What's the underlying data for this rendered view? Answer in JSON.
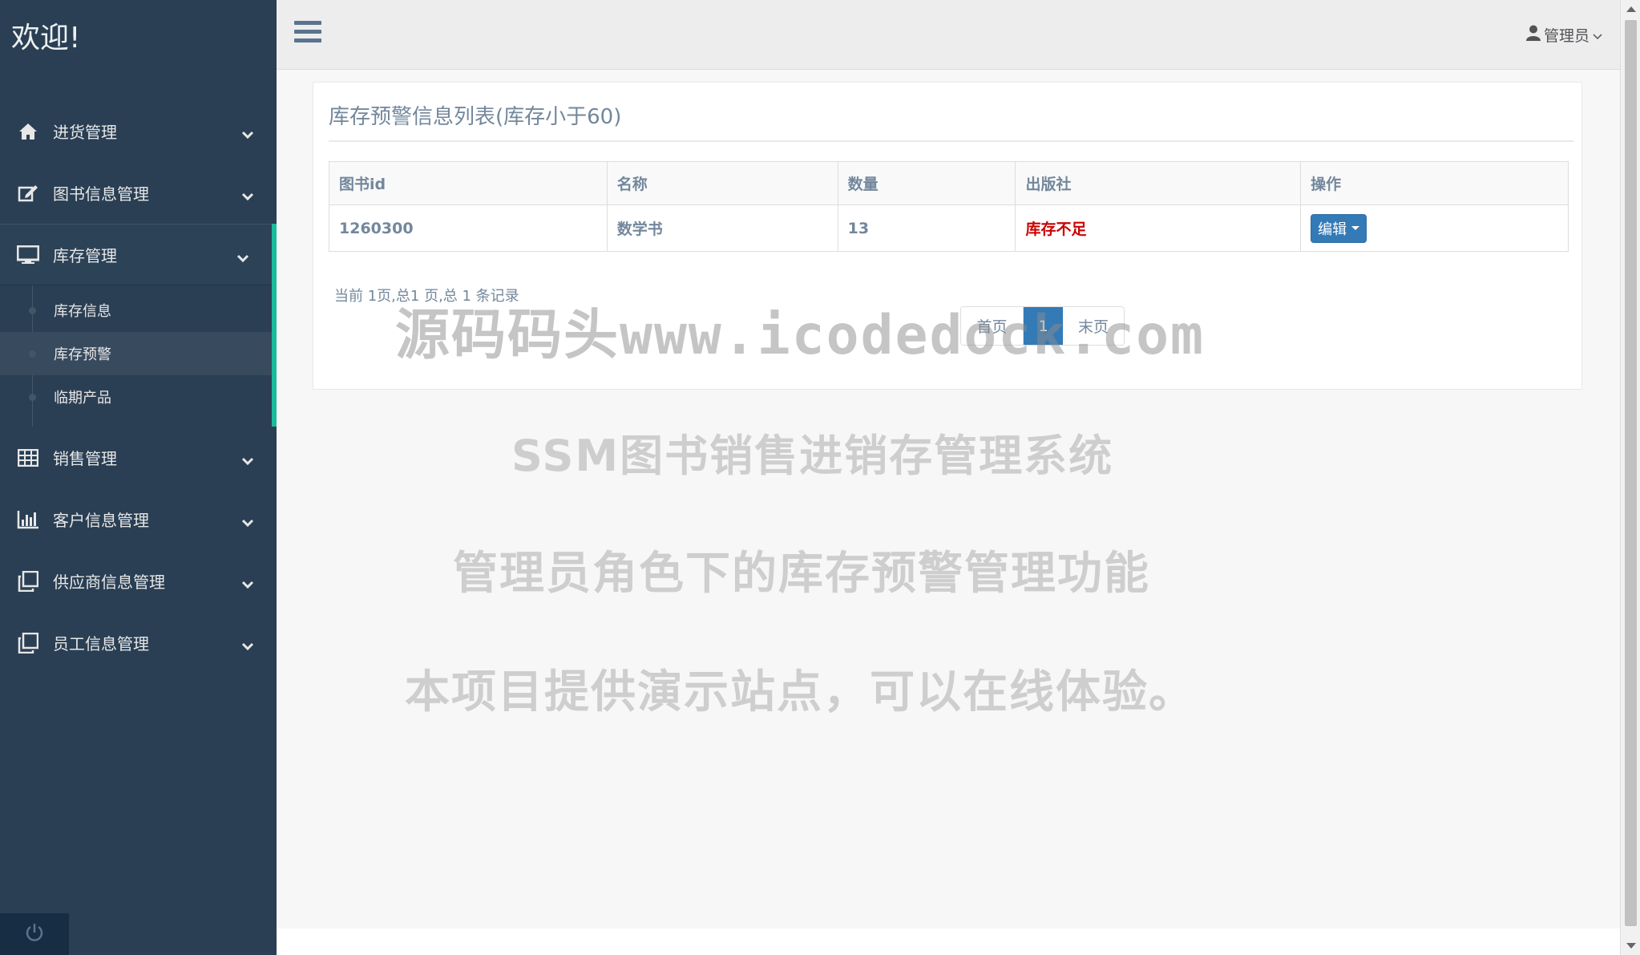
{
  "brand": "欢迎!",
  "sidebar": {
    "items": [
      {
        "label": "进货管理",
        "icon": "home-icon"
      },
      {
        "label": "图书信息管理",
        "icon": "edit-icon"
      },
      {
        "label": "库存管理",
        "icon": "desktop-icon",
        "expanded": true
      },
      {
        "label": "销售管理",
        "icon": "table-icon"
      },
      {
        "label": "客户信息管理",
        "icon": "bar-chart-icon"
      },
      {
        "label": "供应商信息管理",
        "icon": "clone-icon"
      },
      {
        "label": "员工信息管理",
        "icon": "clone-icon"
      }
    ],
    "sub_items": [
      {
        "label": "库存信息"
      },
      {
        "label": "库存预警",
        "current": true
      },
      {
        "label": "临期产品"
      }
    ],
    "footer_icon": "power-icon"
  },
  "topbar": {
    "user_label": "管理员",
    "user_icon": "user-icon"
  },
  "panel": {
    "title": "库存预警信息列表(库存小于60)",
    "columns": [
      "图书id",
      "名称",
      "数量",
      "出版社",
      "操作"
    ],
    "rows": [
      {
        "id": "1260300",
        "name": "数学书",
        "qty": "13",
        "publisher": "库存不足",
        "action": "编辑"
      }
    ],
    "page_info": "当前 1页,总1 页,总 1 条记录",
    "pager": {
      "first": "首页",
      "current": "1",
      "last": "末页"
    }
  },
  "watermarks": [
    "源码码头www.icodedock.com",
    "SSM图书销售进销存管理系统",
    "管理员角色下的库存预警管理功能",
    "本项目提供演示站点，可以在线体验。"
  ],
  "colors": {
    "sidebar": "#2a3f54",
    "accent": "#1abb9c",
    "primary": "#337ab7",
    "warning": "#cc0000"
  }
}
